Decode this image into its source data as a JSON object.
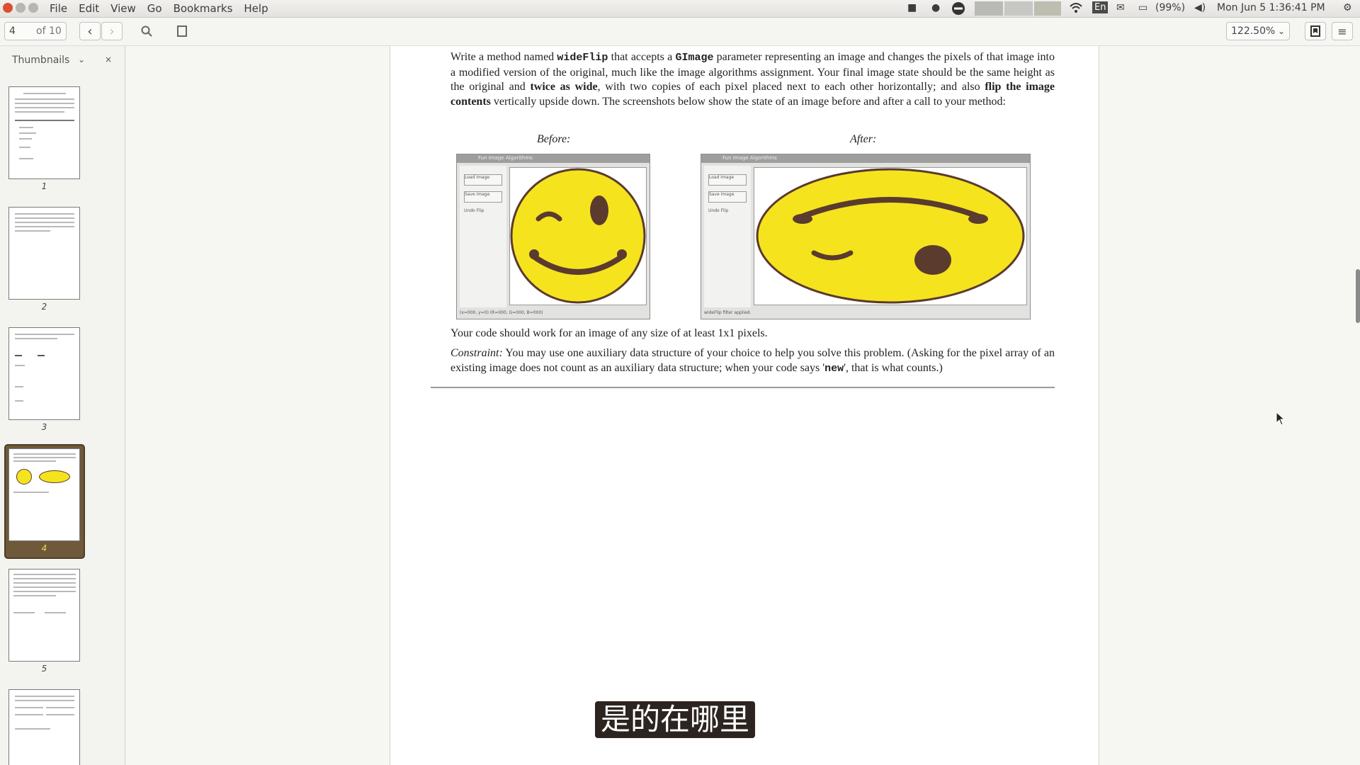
{
  "menubar": {
    "menus": [
      "File",
      "Edit",
      "View",
      "Go",
      "Bookmarks",
      "Help"
    ],
    "keyboard_layout": "En",
    "battery": "(99%)",
    "datetime": "Mon Jun 5   1:36:41 PM"
  },
  "toolbar": {
    "page_current": "4",
    "page_total": "of 10",
    "zoom": "122.50%"
  },
  "sidebar": {
    "header": "Thumbnails",
    "pages": [
      "1",
      "2",
      "3",
      "4",
      "5"
    ],
    "selected_page": "4"
  },
  "document": {
    "p1": {
      "t1": "Write a method named ",
      "code1": "wideFlip",
      "t2": " that accepts a ",
      "code2": "GImage",
      "t3": " parameter representing an image and changes the pixels of that image into a modified version of the original, much like the image algorithms assignment.  Your final image state should be the same height as the original and ",
      "b1": "twice as wide",
      "t4": ", with two copies of each pixel placed next to each other horizontally; and also ",
      "b2": "flip the image contents",
      "t5": " vertically upside down.  The screenshots below show the state of an image before and after a call to your method:"
    },
    "before_caption": "Before:",
    "after_caption": "After:",
    "before_shot": {
      "title": "Fun Image Algorithms",
      "load_label": "Load Image",
      "save_label": "Save Image",
      "side_text": "Undo Flip",
      "status": "(x=000, y=0) (R=000, G=000, B=000)"
    },
    "after_shot": {
      "title": "Fun Image Algorithms",
      "load_label": "Load Image",
      "save_label": "Save Image",
      "side_text": "Undo Flip",
      "status": "wideFlip filter applied."
    },
    "p2": "Your code should work for an image of any size of at least 1x1 pixels.",
    "p3": {
      "label": "Constraint:",
      "t1": " You may use one auxiliary data structure of your choice to help you solve this problem.  (Asking for the pixel array of an existing image does not count as an auxiliary data structure; when your code says '",
      "code": "new",
      "t2": "', that is what counts.)"
    }
  },
  "subtitle": "是的在哪里",
  "colors": {
    "smiley_yellow": "#f5e31e",
    "smiley_outline": "#5a3b2e",
    "selected_thumb": "#6e5a3a"
  }
}
